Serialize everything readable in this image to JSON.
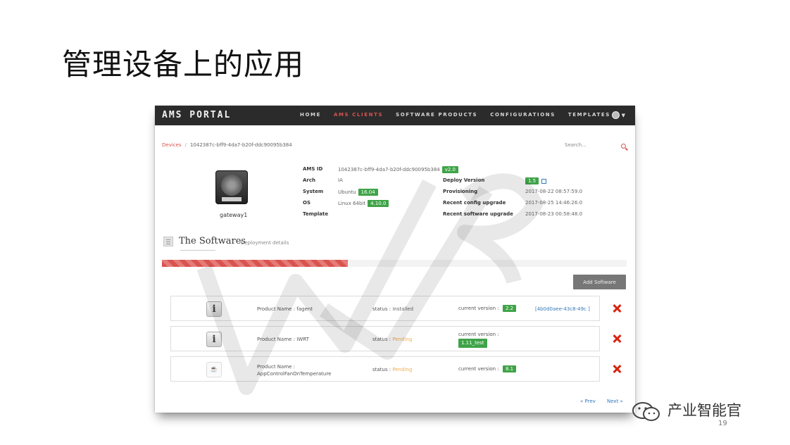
{
  "slide": {
    "title": "管理设备上的应用",
    "brand": "产业智能官",
    "page_number": "19"
  },
  "navbar": {
    "brand": "AMS PORTAL",
    "links": [
      "HOME",
      "AMS CLIENTS",
      "SOFTWARE PRODUCTS",
      "CONFIGURATIONS",
      "TEMPLATES"
    ],
    "active_index": 1
  },
  "breadcrumb": {
    "root": "Devices",
    "current": "1042387c-bff9-4da7-b20f-ddc90095b384"
  },
  "search": {
    "placeholder": "Search..."
  },
  "device": {
    "name": "gateway1",
    "fields": {
      "ams_id_label": "AMS ID",
      "ams_id_value": "1042387c-bff9-4da7-b20f-ddc90095b384",
      "ams_id_badge": "v2.0",
      "arch_label": "Arch",
      "arch_value": "IA",
      "system_label": "System",
      "system_value": "Ubuntu",
      "system_badge": "16.04",
      "os_label": "OS",
      "os_value": "Linux 64bit",
      "os_badge": "4.10.0",
      "template_label": "Template",
      "deploy_label": "Deploy Version",
      "deploy_badge": "1.5",
      "provisioning_label": "Provisioning",
      "provisioning_value": "2017-08-22 08:57:59.0",
      "config_label": "Recent config upgrade",
      "config_value": "2017-08-25 14:46:26.0",
      "software_label": "Recent software upgrade",
      "software_value": "2017-08-23 00:58:48.0"
    }
  },
  "softwares": {
    "title": "The Softwares",
    "subtitle": "Deployment details",
    "progress": 0.4,
    "add_label": "Add Software",
    "status_label": "status",
    "version_label": "current version",
    "items": [
      {
        "name": "Product Name : fagent",
        "status": "installed",
        "version": "2.2",
        "link": "[4b0d0aee-43c8-49c ]"
      },
      {
        "name": "Product Name : IWRT",
        "status": "Pending",
        "version": "1.11_test",
        "link": ""
      },
      {
        "name": "Product Name : AppControlFanOnTemperature",
        "status": "Pending",
        "version": "8.1",
        "link": ""
      }
    ]
  },
  "pager": {
    "prev": "« Prev",
    "next": "Next »"
  },
  "colors": {
    "accent": "#d9534f",
    "badge": "#3fa348",
    "navbar": "#2b2b2b",
    "delete": "#d9230f"
  }
}
